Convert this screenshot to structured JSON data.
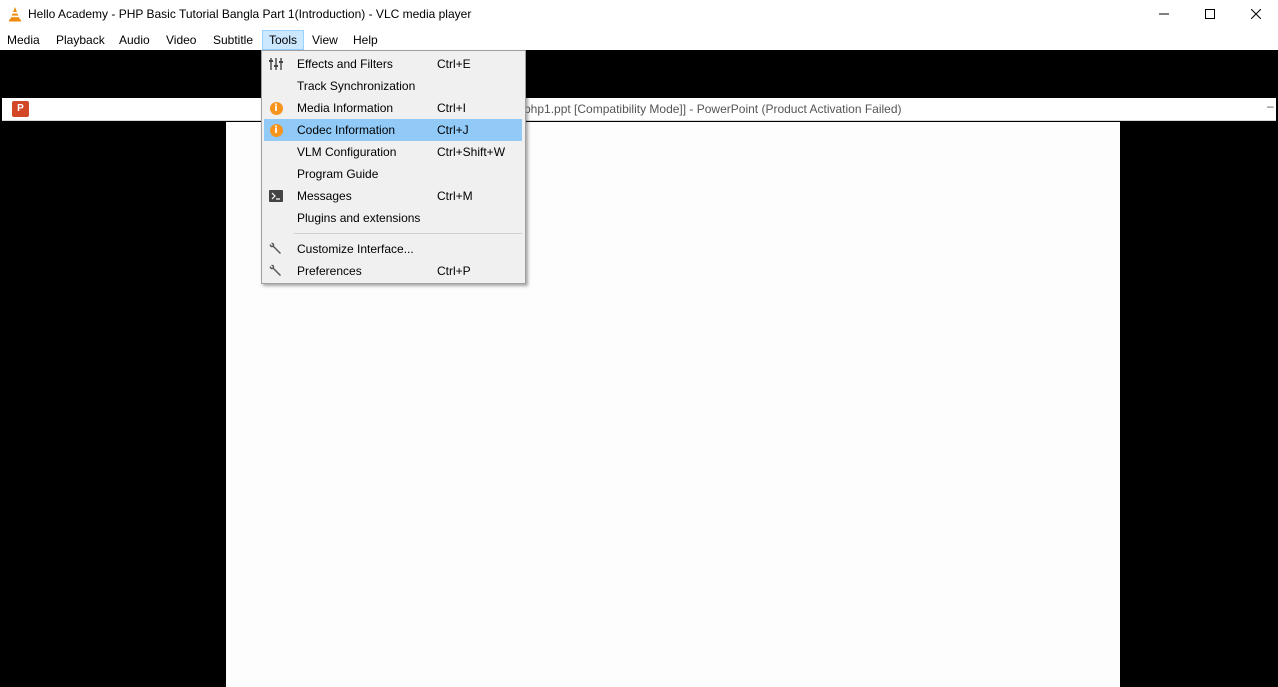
{
  "window": {
    "title": "Hello Academy - PHP Basic Tutorial Bangla Part 1(Introduction) - VLC media player",
    "controls": {
      "minimize": "minimize-icon",
      "maximize": "maximize-icon",
      "close": "close-icon"
    }
  },
  "menubar": {
    "items": [
      "Media",
      "Playback",
      "Audio",
      "Video",
      "Subtitle",
      "Tools",
      "View",
      "Help"
    ],
    "active": "Tools"
  },
  "tools_menu": {
    "items": [
      {
        "label": "Effects and Filters",
        "shortcut": "Ctrl+E",
        "icon": "equalizer-icon"
      },
      {
        "label": "Track Synchronization",
        "shortcut": "",
        "icon": ""
      },
      {
        "label": "Media Information",
        "shortcut": "Ctrl+I",
        "icon": "info-icon"
      },
      {
        "label": "Codec Information",
        "shortcut": "Ctrl+J",
        "icon": "info-icon",
        "highlighted": true
      },
      {
        "label": "VLM Configuration",
        "shortcut": "Ctrl+Shift+W",
        "icon": ""
      },
      {
        "label": "Program Guide",
        "shortcut": "",
        "icon": ""
      },
      {
        "label": "Messages",
        "shortcut": "Ctrl+M",
        "icon": "terminal-icon"
      },
      {
        "label": "Plugins and extensions",
        "shortcut": "",
        "icon": ""
      },
      {
        "label": "Customize Interface...",
        "shortcut": "",
        "icon": "wrench-icon"
      },
      {
        "label": "Preferences",
        "shortcut": "Ctrl+P",
        "icon": "wrench-icon"
      }
    ]
  },
  "video_content": {
    "powerpoint_title": "php1.ppt [Compatibility Mode]] - PowerPoint (Product Activation Failed)",
    "powerpoint_icon_letter": "P"
  },
  "colors": {
    "menu_highlight": "#91c9f7",
    "menubar_active": "#cce8ff",
    "info_icon": "#f7941d",
    "video_bg": "#000000",
    "powerpoint": "#d24726"
  }
}
